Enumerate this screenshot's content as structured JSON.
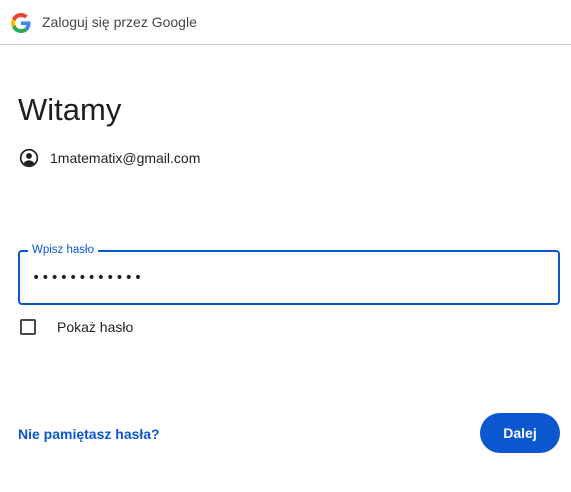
{
  "header": {
    "title": "Zaloguj się przez Google",
    "logo_icon": "google-g-icon"
  },
  "main": {
    "heading": "Witamy",
    "account": {
      "icon": "account-circle-icon",
      "email": "1matematix@gmail.com"
    },
    "password_field": {
      "label": "Wpisz hasło",
      "value": "••••••••••••"
    },
    "show_password": {
      "label": "Pokaż hasło",
      "checked": false
    },
    "forgot_link": "Nie pamiętasz hasła?",
    "next_button": "Dalej"
  },
  "colors": {
    "accent": "#0b57d0",
    "text": "#1f1f1f",
    "divider": "#c4c7c5"
  }
}
